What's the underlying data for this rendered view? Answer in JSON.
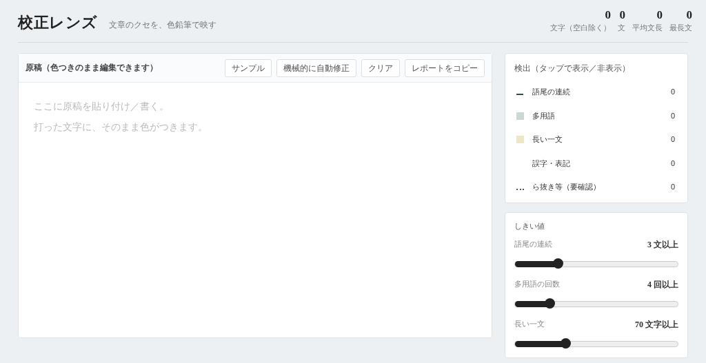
{
  "header": {
    "title": "校正レンズ",
    "subtitle": "文章のクセを、色鉛筆で映す",
    "stats": [
      {
        "value": "0",
        "label": "文字（空白除く）"
      },
      {
        "value": "0",
        "label": "文"
      },
      {
        "value": "0",
        "label": "平均文長"
      },
      {
        "value": "0",
        "label": "最長文"
      }
    ]
  },
  "editor": {
    "title": "原稿（色つきのまま編集できます）",
    "buttons": [
      "サンプル",
      "機械的に自動修正",
      "クリア",
      "レポートをコピー"
    ],
    "placeholder_lines": [
      "ここに原稿を貼り付け／書く。",
      "打った文字に、そのまま色がつきます。"
    ]
  },
  "detection": {
    "title": "検出（タップで表示／非表示）",
    "items": [
      {
        "kind": "underline",
        "color": "#2f4f4f",
        "label": "語尾の連続",
        "count": "0"
      },
      {
        "kind": "swatch",
        "color": "#c9d8d3",
        "label": "多用語",
        "count": "0"
      },
      {
        "kind": "swatch",
        "color": "#efe6c8",
        "label": "長い一文",
        "count": "0"
      },
      {
        "kind": "none",
        "label": "誤字・表記",
        "count": "0"
      },
      {
        "kind": "dotted",
        "color": "#555555",
        "label": "ら抜き等（要確認）",
        "count": "0"
      }
    ]
  },
  "thresholds": {
    "title": "しきい値",
    "sliders": [
      {
        "label": "語尾の連続",
        "reading": "3 文以上",
        "level": 0.26
      },
      {
        "label": "多用語の回数",
        "reading": "4 回以上",
        "level": 0.21
      },
      {
        "label": "長い一文",
        "reading": "70 文字以上",
        "level": 0.31
      }
    ]
  }
}
